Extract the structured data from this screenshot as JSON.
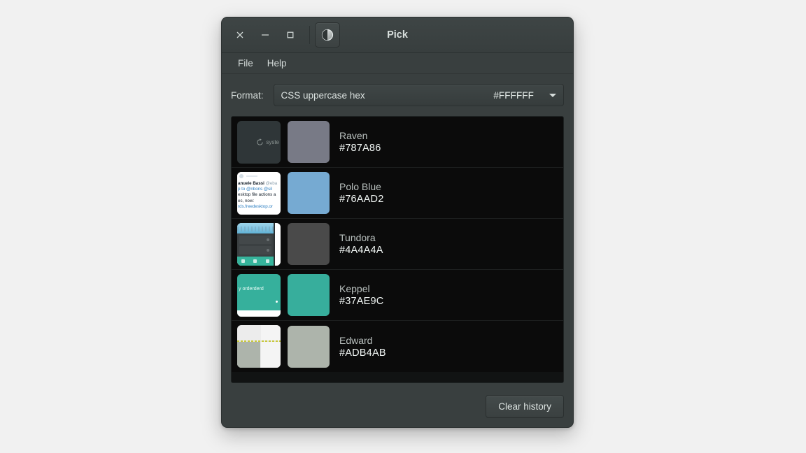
{
  "window": {
    "title": "Pick",
    "controls": {
      "close_label": "×",
      "minimize_label": "−",
      "maximize_label": "□"
    },
    "app_icon": "pick-circle-icon"
  },
  "menubar": {
    "items": [
      {
        "label": "File"
      },
      {
        "label": "Help"
      }
    ]
  },
  "format": {
    "label": "Format:",
    "selected": "CSS uppercase hex",
    "sample": "#FFFFFF",
    "arrow_icon": "chevron-down-icon"
  },
  "history": {
    "rows": [
      {
        "name": "Raven",
        "hex": "#787A86",
        "swatch_color": "#787a86",
        "thumb_kind": "system",
        "thumb_text": "syste",
        "thumb_icon": "refresh-icon"
      },
      {
        "name": "Polo Blue",
        "hex": "#76AAD2",
        "swatch_color": "#76aad2",
        "thumb_kind": "tweet",
        "tweet": {
          "author": "anuele Bassi",
          "handle": "@eba",
          "reply": "p to @nbons @sil",
          "line1": "esktop file actions a",
          "line2": "ec, now:",
          "link": "rds.freedesktop.or"
        }
      },
      {
        "name": "Tundora",
        "hex": "#4A4A4A",
        "swatch_color": "#4a4a4a",
        "thumb_kind": "mobile"
      },
      {
        "name": "Keppel",
        "hex": "#37AE9C",
        "swatch_color": "#37ae9c",
        "thumb_kind": "teal",
        "thumb_text": "y orderderd"
      },
      {
        "name": "Edward",
        "hex": "#ADB4AB",
        "swatch_color": "#adb4ab",
        "thumb_kind": "edward"
      }
    ]
  },
  "footer": {
    "clear_history_label": "Clear history"
  }
}
